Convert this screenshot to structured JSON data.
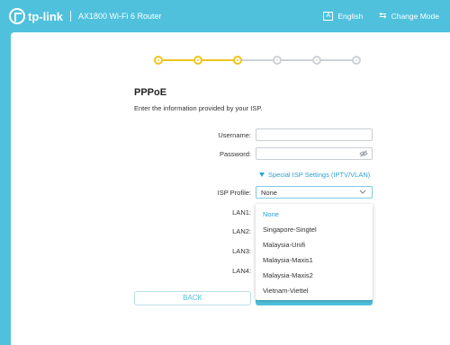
{
  "header": {
    "brand": "tp-link",
    "model": "AX1800 Wi-Fi 6 Router",
    "language_label": "English",
    "language_icon": "A",
    "change_mode_label": "Change Mode",
    "change_mode_icon": "⇆"
  },
  "steps": {
    "total": 6,
    "completed": 3,
    "colors": {
      "done": "#f0c419",
      "todo": "#cdd1d6"
    }
  },
  "form": {
    "title": "PPPoE",
    "subtitle": "Enter the information provided by your ISP.",
    "username_label": "Username:",
    "username_value": "",
    "password_label": "Password:",
    "password_value": "",
    "special_settings_label": "Special ISP Settings (IPTV/VLAN)",
    "isp_profile_label": "ISP Profile:",
    "isp_profile_value": "None",
    "lan1_label": "LAN1:",
    "lan2_label": "LAN2:",
    "lan3_label": "LAN3:",
    "lan4_label": "LAN4:"
  },
  "dropdown": {
    "options": [
      "None",
      "Singapore-Singtel",
      "Malaysia-Unifi",
      "Malaysia-Maxis1",
      "Malaysia-Maxis2",
      "Vietnam-Viettel"
    ],
    "selected": "None"
  },
  "buttons": {
    "back_label": "BACK",
    "next_label": ""
  },
  "colors": {
    "accent": "#4fc1dd",
    "link": "#2ba2d4"
  }
}
